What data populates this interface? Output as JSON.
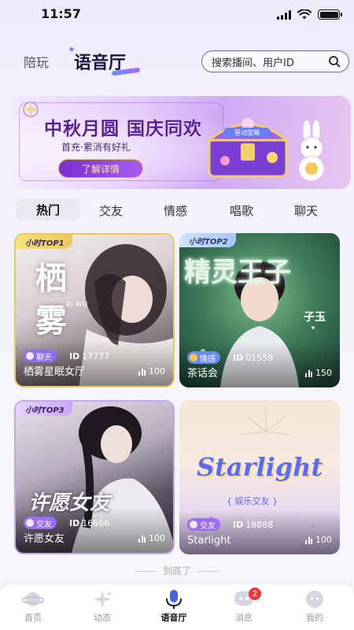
{
  "status_bar": {
    "time": "11:57"
  },
  "header": {
    "tab_peiwan": "陪玩",
    "tab_yuyin": "语音厅",
    "search_placeholder": "搜索播间、用户ID"
  },
  "banner": {
    "title": "中秋月圆 国庆同欢",
    "subtitle": "首充·累消有好礼",
    "button_label": "了解详情",
    "chest_label": "星动宝箱"
  },
  "category_tabs": [
    {
      "label": "热门",
      "active": true
    },
    {
      "label": "交友",
      "active": false
    },
    {
      "label": "情感",
      "active": false
    },
    {
      "label": "唱歌",
      "active": false
    },
    {
      "label": "聊天",
      "active": false
    }
  ],
  "rooms": [
    {
      "badge": "小时TOP1",
      "tag": "聊天",
      "tag_color": "#8f6cf2",
      "id_label": "ID",
      "id": "17777",
      "name": "栖雾星眠女厅",
      "listeners": "100",
      "art_text": "栖 雾",
      "art_sub": "XI WU"
    },
    {
      "badge": "小时TOP2",
      "tag": "情感",
      "tag_color": "#6a8cf0",
      "id_label": "ID",
      "id": "01559",
      "name": "茶话会",
      "listeners": "150",
      "art_text": "精灵王子",
      "art_sub": "子玉"
    },
    {
      "badge": "小时TOP3",
      "tag": "交友",
      "tag_color": "#9a6cf0",
      "id_label": "ID",
      "id": "16666",
      "name": "许愿女友",
      "listeners": "100",
      "art_text": "许愿女友",
      "art_sub": ""
    },
    {
      "badge": "",
      "tag": "交友",
      "tag_color": "#9a6cf0",
      "id_label": "ID",
      "id": "18888",
      "name": "Starlight",
      "listeners": "100",
      "art_text": "Starlight",
      "art_sub": "{ 娱乐交友 }"
    }
  ],
  "end_note": "到底了",
  "bottom_nav": [
    {
      "label": "首页",
      "active": false,
      "icon": "planet-icon"
    },
    {
      "label": "动态",
      "active": false,
      "icon": "sparkle-icon"
    },
    {
      "label": "语音厅",
      "active": true,
      "icon": "microphone-icon"
    },
    {
      "label": "消息",
      "active": false,
      "icon": "chat-icon",
      "badge": "2"
    },
    {
      "label": "我的",
      "active": false,
      "icon": "profile-icon"
    }
  ],
  "colors": {
    "accent": "#7b3fd6",
    "badge_gold": "#f1d86f",
    "notification": "#f03a3a"
  }
}
